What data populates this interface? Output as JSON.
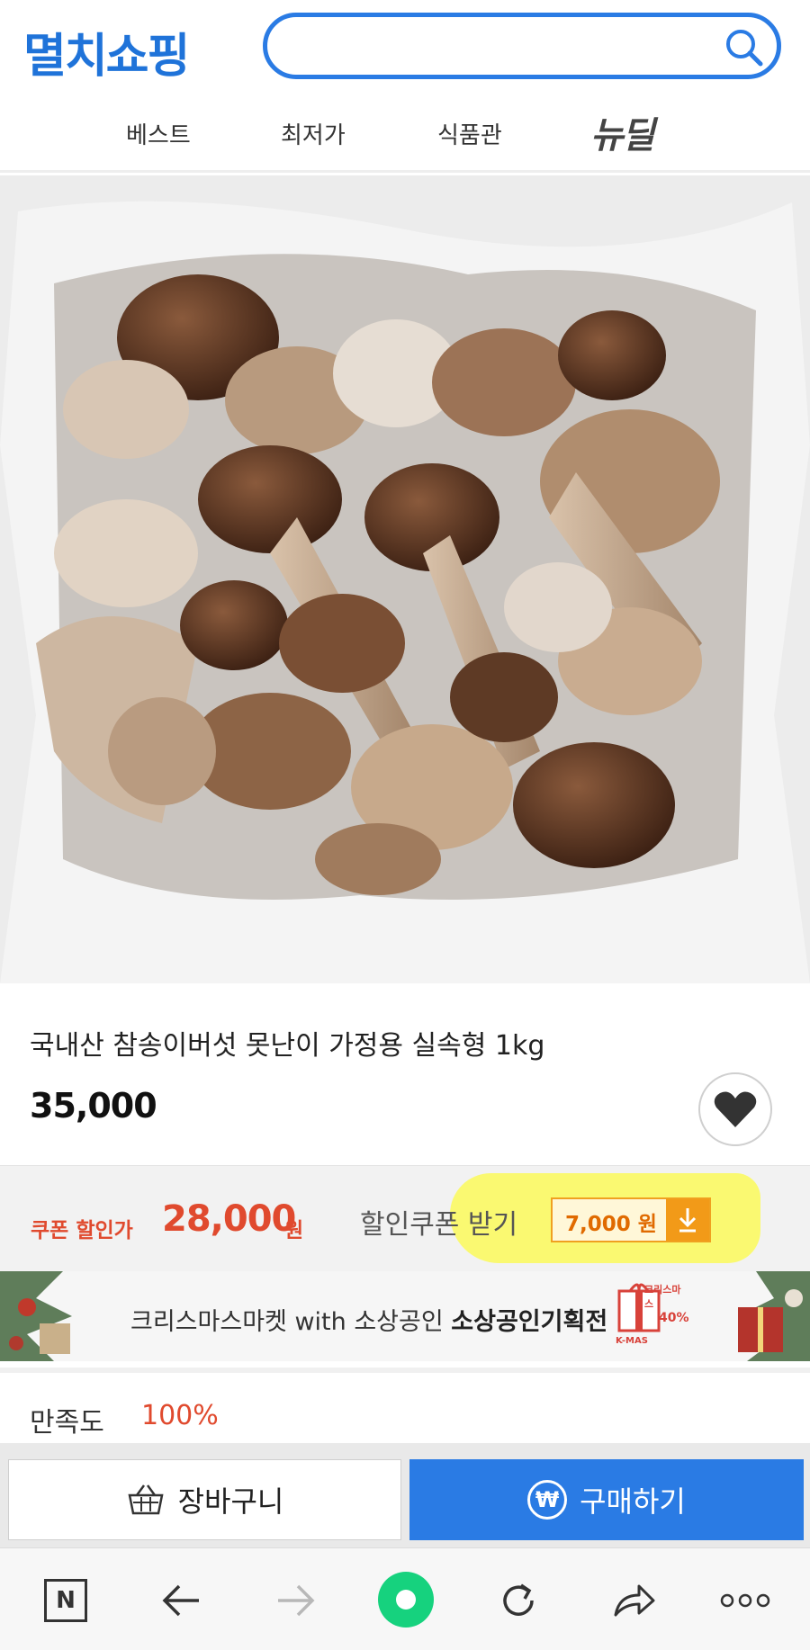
{
  "header": {
    "logo_text": "멸치쇼핑",
    "search": {
      "placeholder": "",
      "icon": "search-icon"
    }
  },
  "nav": {
    "items": [
      {
        "label": "베스트"
      },
      {
        "label": "최저가"
      },
      {
        "label": "식품관"
      },
      {
        "label": "뉴딜"
      }
    ]
  },
  "product": {
    "image_alt": "",
    "title": "국내산 참송이버섯 못난이 가정용 실속형 1kg",
    "price": "35,000",
    "wish_icon": "heart-icon"
  },
  "coupon": {
    "label": "쿠폰 할인가",
    "price": "28,000",
    "unit": "원",
    "get_label": "할인쿠폰 받기",
    "chip_value": "7,000 원",
    "download_icon": "download-icon",
    "highlight_color": "#fcfa5a"
  },
  "banner": {
    "text_prefix": "크리스마스마켓 with 소상공인 ",
    "text_bold": "소상공인기획전",
    "badge_top": "크리스마스",
    "badge_discount": "40%",
    "badge_brand": "K-MAS"
  },
  "satisfaction": {
    "label": "만족도",
    "value": "100%"
  },
  "actions": {
    "cart_label": "장바구니",
    "buy_label": "구매하기",
    "buy_icon_symbol": "₩"
  },
  "browser_bar": {
    "home_letter": "N",
    "icons": [
      "naver-home-icon",
      "back-icon",
      "forward-icon",
      "green-dot-icon",
      "refresh-icon",
      "share-icon",
      "more-icon"
    ]
  },
  "colors": {
    "brand_blue": "#2a7be4",
    "sale_red": "#e04a2e",
    "coupon_orange": "#f29a18"
  }
}
